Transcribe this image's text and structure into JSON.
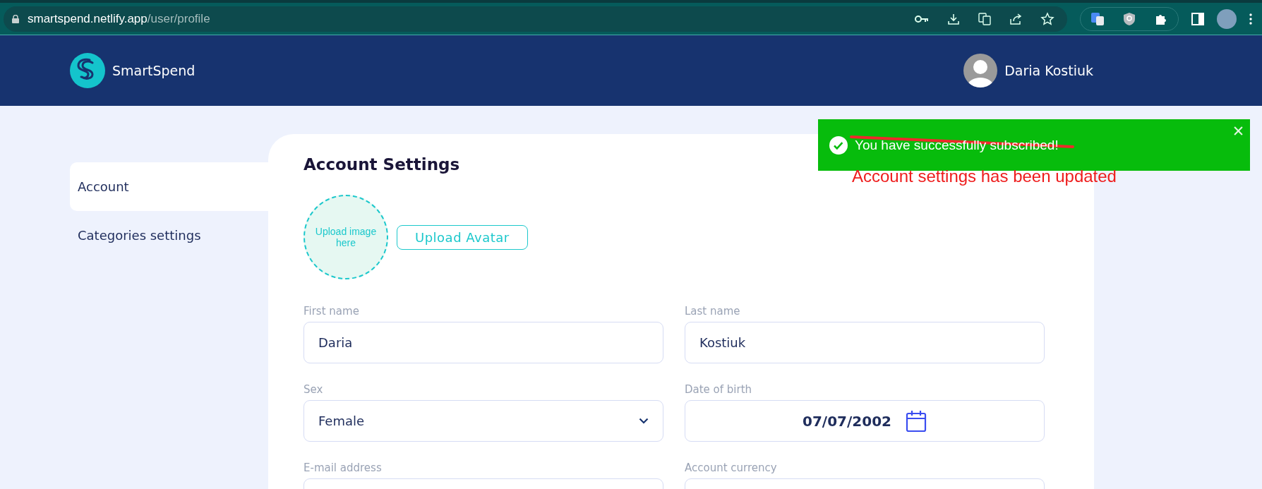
{
  "browser": {
    "url_host": "smartspend.netlify.app",
    "url_path": "/user/profile"
  },
  "header": {
    "brand": "SmartSpend",
    "user_name": "Daria Kostiuk"
  },
  "sidebar": {
    "items": [
      {
        "label": "Account",
        "selected": true
      },
      {
        "label": "Categories settings",
        "selected": false
      }
    ]
  },
  "card": {
    "title": "Account Settings",
    "avatar_placeholder": "Upload image here",
    "upload_button": "Upload Avatar",
    "fields": [
      {
        "label": "First name",
        "value": "Daria",
        "kind": "text"
      },
      {
        "label": "Last name",
        "value": "Kostiuk",
        "kind": "text"
      },
      {
        "label": "Sex",
        "value": "Female",
        "kind": "select"
      },
      {
        "label": "Date of birth",
        "value": "07/07/2002",
        "kind": "date"
      },
      {
        "label": "E-mail address",
        "kind": "text"
      },
      {
        "label": "Account currency",
        "kind": "text"
      }
    ]
  },
  "toast": {
    "message": "You have successfully subscribed!",
    "struck_out": true,
    "annotation": "Account settings has been updated"
  }
}
